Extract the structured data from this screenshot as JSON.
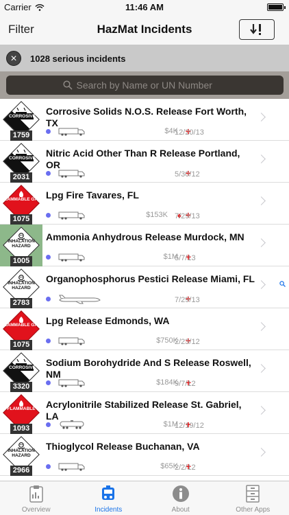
{
  "status": {
    "carrier": "Carrier",
    "time": "11:46 AM"
  },
  "nav": {
    "filter_label": "Filter",
    "title": "HazMat Incidents"
  },
  "filter": {
    "text": "1028 serious incidents"
  },
  "search": {
    "placeholder": "Search by Name or UN Number"
  },
  "colors": {
    "accent": "#1a73e8",
    "dot": "#6a6ef0",
    "cross": "#e41a1c",
    "filter_bar": "#c9c9c9",
    "search_bg": "#a39e99"
  },
  "incidents": [
    {
      "title": "Corrosive Solids  N.O.S. Release Fort Worth, TX",
      "un": "1759",
      "placard": "corrosive",
      "placard_text": "CORROSIVE",
      "vehicle": "truck-icon",
      "cost": "$4K",
      "flame": false,
      "date": "12/20/13"
    },
    {
      "title": "Nitric Acid Other Than R Release Portland, OR",
      "un": "2031",
      "placard": "corrosive",
      "placard_text": "CORROSIVE",
      "vehicle": "truck-icon",
      "cost": "",
      "flame": false,
      "date": "5/30/12"
    },
    {
      "title": "Lpg Fire Tavares, FL",
      "un": "1075",
      "placard": "flammable",
      "placard_text": "FLAMMABLE GAS",
      "vehicle": "truck-icon",
      "cost": "$153K",
      "flame": true,
      "date": "7/29/13"
    },
    {
      "title": "Ammonia Anhydrous Release Murdock, MN",
      "un": "1005",
      "placard": "inhalation",
      "placard_text": "INHALATION HAZARD",
      "vehicle": "truck-icon",
      "cost": "$1M",
      "flame": false,
      "date": "5/7/13",
      "highlight": true
    },
    {
      "title": "Organophosphorus Pestici Release Miami, FL",
      "un": "2783",
      "placard": "inhalation",
      "placard_text": "INHALATION HAZARD",
      "vehicle": "airplane-icon",
      "cost": "",
      "flame": false,
      "date": "7/29/13"
    },
    {
      "title": "Lpg Release Edmonds, WA",
      "un": "1075",
      "placard": "flammable",
      "placard_text": "FLAMMABLE GAS",
      "vehicle": "truck-icon",
      "cost": "$750K",
      "flame": false,
      "date": "2/23/12"
    },
    {
      "title": "Sodium Borohydride And S Release Roswell, NM",
      "un": "3320",
      "placard": "corrosive",
      "placard_text": "CORROSIVE",
      "vehicle": "truck-icon",
      "cost": "$184K",
      "flame": false,
      "date": "9/7/12"
    },
    {
      "title": "Acrylonitrile  Stabilized Release St. Gabriel, LA",
      "un": "1093",
      "placard": "flammable",
      "placard_text": "FLAMMABLE",
      "vehicle": "tank-car-icon",
      "cost": "$1M",
      "flame": false,
      "date": "12/19/12"
    },
    {
      "title": "Thioglycol Release Buchanan, VA",
      "un": "2966",
      "placard": "inhalation",
      "placard_text": "INHALATION HAZARD",
      "vehicle": "truck-icon",
      "cost": "$65K",
      "flame": false,
      "date": "2/2/12"
    }
  ],
  "tabs": [
    {
      "label": "Overview",
      "icon": "clipboard-icon",
      "active": false
    },
    {
      "label": "Incidents",
      "icon": "fire-truck-icon",
      "active": true
    },
    {
      "label": "About",
      "icon": "info-icon",
      "active": false
    },
    {
      "label": "Other Apps",
      "icon": "cabinet-icon",
      "active": false
    }
  ]
}
